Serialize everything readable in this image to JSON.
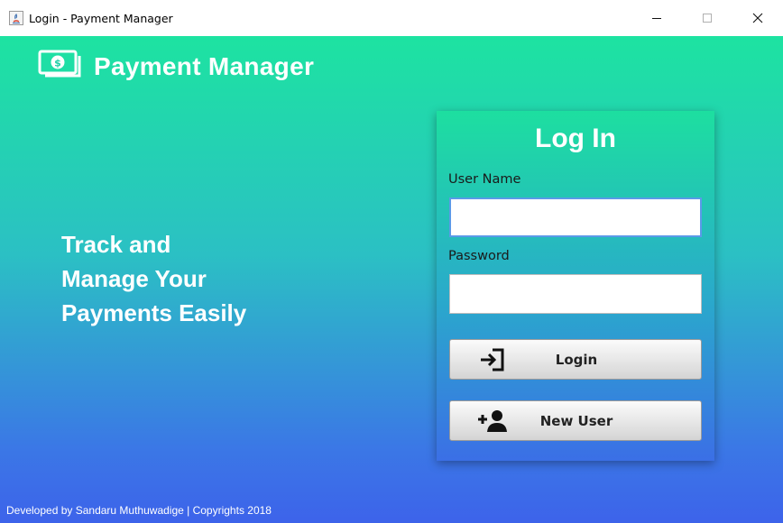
{
  "window": {
    "title": "Login - Payment Manager",
    "controls": [
      "minimize-icon",
      "maximize-icon",
      "close-icon"
    ]
  },
  "brand": {
    "name": "Payment Manager",
    "icon": "money-bill-icon"
  },
  "tagline": {
    "line1": "Track and",
    "line2": "Manage Your",
    "line3": "Payments Easily"
  },
  "login": {
    "title": "Log In",
    "username_label": "User Name",
    "username_value": "",
    "password_label": "Password",
    "password_value": "",
    "login_button": "Login",
    "login_icon": "sign-in-icon",
    "new_user_button": "New User",
    "new_user_icon": "user-plus-icon"
  },
  "footer": {
    "text": "Developed by Sandaru Muthuwadige | Copyrights 2018"
  },
  "colors": {
    "gradient_top": "#1de3a1",
    "gradient_bottom": "#3d63ea",
    "text_on_gradient": "#ffffff"
  }
}
